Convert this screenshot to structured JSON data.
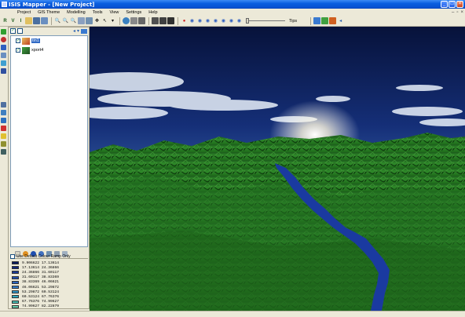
{
  "window": {
    "title": "ISIS Mapper - [New Project]"
  },
  "menu": {
    "items": [
      "Project",
      "GIS Theme",
      "Modelling",
      "Tools",
      "View",
      "Settings",
      "Help"
    ]
  },
  "toolbar": {
    "tips_label": "Tips"
  },
  "layers": {
    "items": [
      {
        "name": "tin1",
        "checked": true,
        "selected": true,
        "icon": "tin-layer-icon"
      },
      {
        "name": "xport4",
        "checked": true,
        "selected": false,
        "icon": "raster-layer-icon"
      }
    ]
  },
  "colour_ramp": {
    "label": "Use Default Colour Ramp Only",
    "checked": false,
    "classes": [
      {
        "from": "9.906622",
        "to": "17.13614",
        "color": "#0a1a5e"
      },
      {
        "from": "17.13614",
        "to": "24.36866",
        "color": "#12287a"
      },
      {
        "from": "24.36866",
        "to": "31.60117",
        "color": "#1a3a96"
      },
      {
        "from": "31.60117",
        "to": "38.83369",
        "color": "#214fae"
      },
      {
        "from": "38.83369",
        "to": "46.06621",
        "color": "#2a64be"
      },
      {
        "from": "46.06621",
        "to": "53.29872",
        "color": "#2f7ac8"
      },
      {
        "from": "53.29872",
        "to": "60.53124",
        "color": "#2d92c4"
      },
      {
        "from": "60.53124",
        "to": "67.76376",
        "color": "#2fa7bb"
      },
      {
        "from": "67.76376",
        "to": "74.99627",
        "color": "#45b9b0"
      },
      {
        "from": "74.99627",
        "to": "82.22879",
        "color": "#63c9a6"
      }
    ]
  }
}
